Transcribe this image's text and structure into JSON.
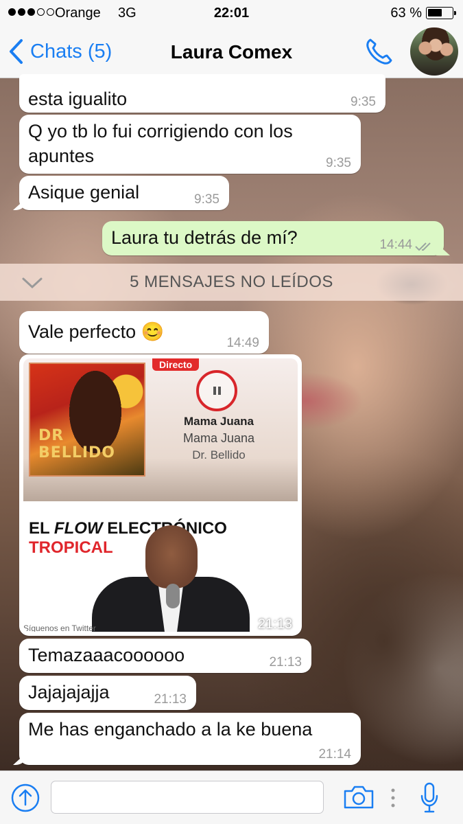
{
  "status_bar": {
    "carrier": "Orange",
    "network": "3G",
    "time": "22:01",
    "battery": "63 %",
    "battery_level": 0.63,
    "signal_bars": 3
  },
  "nav": {
    "back_label": "Chats (5)",
    "title": "Laura Comex"
  },
  "messages": [
    {
      "text": "esta igualito",
      "time": "9:35",
      "direction": "incoming"
    },
    {
      "text": "Q yo tb lo fui corrigiendo con los apuntes",
      "line1": "Q yo tb lo fui corrigiendo con los",
      "line2": "apuntes",
      "time": "9:35",
      "direction": "incoming"
    },
    {
      "text": "Asique genial",
      "time": "9:35",
      "direction": "incoming"
    },
    {
      "text": "Laura tu detrás de mí?",
      "time": "14:44",
      "direction": "outgoing",
      "read": true
    },
    {
      "text": "Vale perfecto 😊",
      "time": "14:49",
      "direction": "incoming"
    },
    {
      "text": "Temazaaacoooooo",
      "time": "21:13",
      "direction": "incoming"
    },
    {
      "text": "Jajajajajja",
      "time": "21:13",
      "direction": "incoming"
    },
    {
      "text": "Me has enganchado a la ke buena",
      "time": "21:14",
      "direction": "incoming"
    }
  ],
  "unread_banner": "5 MENSAJES NO LEÍDOS",
  "media": {
    "time": "21:13",
    "live_badge": "Directo",
    "cover_text": "DR BELLIDO",
    "song_title": "Mama Juana",
    "song_album": "Mama Juana",
    "song_artist": "Dr. Bellido",
    "promo_line1_a": "EL ",
    "promo_line1_b": "FLOW",
    "promo_line1_c": " ELECTRÓNICO",
    "promo_line2": "TROPICAL",
    "footer": "Síguenos en Twitter"
  },
  "input": {
    "placeholder": ""
  },
  "colors": {
    "accent": "#1a7ef2",
    "outgoing_bubble": "#dcf8c6",
    "incoming_bubble": "#ffffff"
  },
  "icons": [
    "chevron-left-icon",
    "phone-icon",
    "double-check-icon",
    "chevron-down-icon",
    "pause-icon",
    "upload-arrow-icon",
    "camera-icon",
    "more-vertical-icon",
    "microphone-icon"
  ]
}
